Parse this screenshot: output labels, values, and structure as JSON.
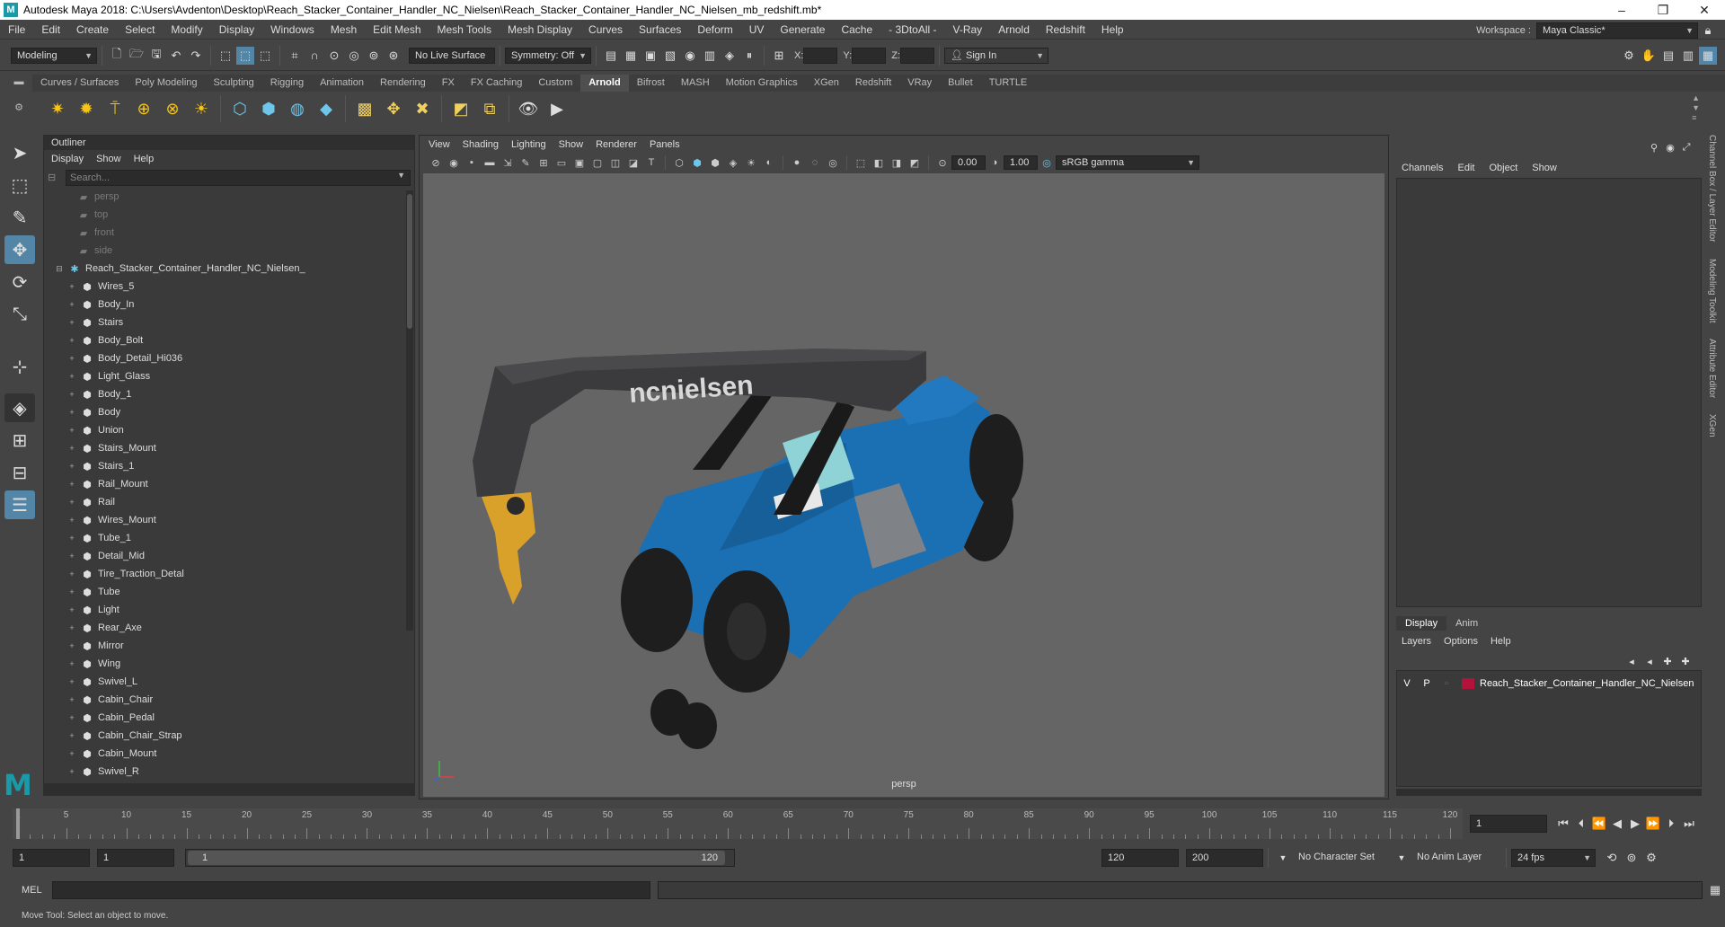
{
  "titlebar": {
    "title": "Autodesk Maya 2018: C:\\Users\\Avdenton\\Desktop\\Reach_Stacker_Container_Handler_NC_Nielsen\\Reach_Stacker_Container_Handler_NC_Nielsen_mb_redshift.mb*",
    "minimize": "–",
    "restore": "❐",
    "close": "✕"
  },
  "menubar": {
    "items": [
      "File",
      "Edit",
      "Create",
      "Select",
      "Modify",
      "Display",
      "Windows",
      "Mesh",
      "Edit Mesh",
      "Mesh Tools",
      "Mesh Display",
      "Curves",
      "Surfaces",
      "Deform",
      "UV",
      "Generate",
      "Cache",
      "- 3DtoAll -",
      "V-Ray",
      "Arnold",
      "Redshift",
      "Help"
    ],
    "workspace_label": "Workspace :",
    "workspace_value": "Maya Classic*"
  },
  "statusline": {
    "mode": "Modeling",
    "live_surface": "No Live Surface",
    "symmetry": "Symmetry: Off",
    "x_label": "X:",
    "y_label": "Y:",
    "z_label": "Z:",
    "sign_in": "Sign In"
  },
  "shelf": {
    "tabs": [
      "Curves / Surfaces",
      "Poly Modeling",
      "Sculpting",
      "Rigging",
      "Animation",
      "Rendering",
      "FX",
      "FX Caching",
      "Custom",
      "Arnold",
      "Bifrost",
      "MASH",
      "Motion Graphics",
      "XGen",
      "Redshift",
      "VRay",
      "Bullet",
      "TURTLE"
    ],
    "active_tab": "Arnold"
  },
  "outliner": {
    "title": "Outliner",
    "menu": [
      "Display",
      "Show",
      "Help"
    ],
    "search_placeholder": "Search...",
    "cameras": [
      "persp",
      "top",
      "front",
      "side"
    ],
    "root": "Reach_Stacker_Container_Handler_NC_Nielsen_",
    "items": [
      "Wires_5",
      "Body_In",
      "Stairs",
      "Body_Bolt",
      "Body_Detail_Hi036",
      "Light_Glass",
      "Body_1",
      "Body",
      "Union",
      "Stairs_Mount",
      "Stairs_1",
      "Rail_Mount",
      "Rail",
      "Wires_Mount",
      "Tube_1",
      "Detail_Mid",
      "Tire_Traction_Detal",
      "Tube",
      "Light",
      "Rear_Axe",
      "Mirror",
      "Wing",
      "Swivel_L",
      "Cabin_Chair",
      "Cabin_Pedal",
      "Cabin_Chair_Strap",
      "Cabin_Mount",
      "Swivel_R"
    ]
  },
  "viewport": {
    "menu": [
      "View",
      "Shading",
      "Lighting",
      "Show",
      "Renderer",
      "Panels"
    ],
    "exposure": "0.00",
    "gamma": "1.00",
    "colorspace": "sRGB gamma",
    "camera_label": "persp",
    "boom_text": "ncnielsen",
    "colors": {
      "body": "#1b6fb3",
      "boom": "#3b3b3d",
      "cab_glass": "#8fd3d6",
      "hook": "#d9a12a",
      "tire": "#1e1e1e"
    }
  },
  "channelbox": {
    "menu": [
      "Channels",
      "Edit",
      "Object",
      "Show"
    ],
    "layer_tabs": [
      "Display",
      "Anim"
    ],
    "layer_menu": [
      "Layers",
      "Options",
      "Help"
    ],
    "layer": {
      "v": "V",
      "p": "P",
      "name": "Reach_Stacker_Container_Handler_NC_Nielsen",
      "color": "#b3123b"
    },
    "side_tabs": [
      "Channel Box / Layer Editor",
      "Modeling Toolkit",
      "Attribute Editor",
      "XGen"
    ]
  },
  "timeline": {
    "ticks": [
      "1",
      "5",
      "10",
      "15",
      "20",
      "25",
      "30",
      "35",
      "40",
      "45",
      "50",
      "55",
      "60",
      "65",
      "70",
      "75",
      "80",
      "85",
      "90",
      "95",
      "100",
      "105",
      "110",
      "115",
      "120"
    ],
    "current_frame": "1"
  },
  "range": {
    "start": "1",
    "anim_start": "1",
    "range_start": "1",
    "range_end": "120",
    "end": "120",
    "anim_end": "200",
    "character_set": "No Character Set",
    "anim_layer": "No Anim Layer",
    "fps": "24 fps"
  },
  "cmdline": {
    "label": "MEL"
  },
  "helpline": {
    "text": "Move Tool: Select an object to move."
  }
}
